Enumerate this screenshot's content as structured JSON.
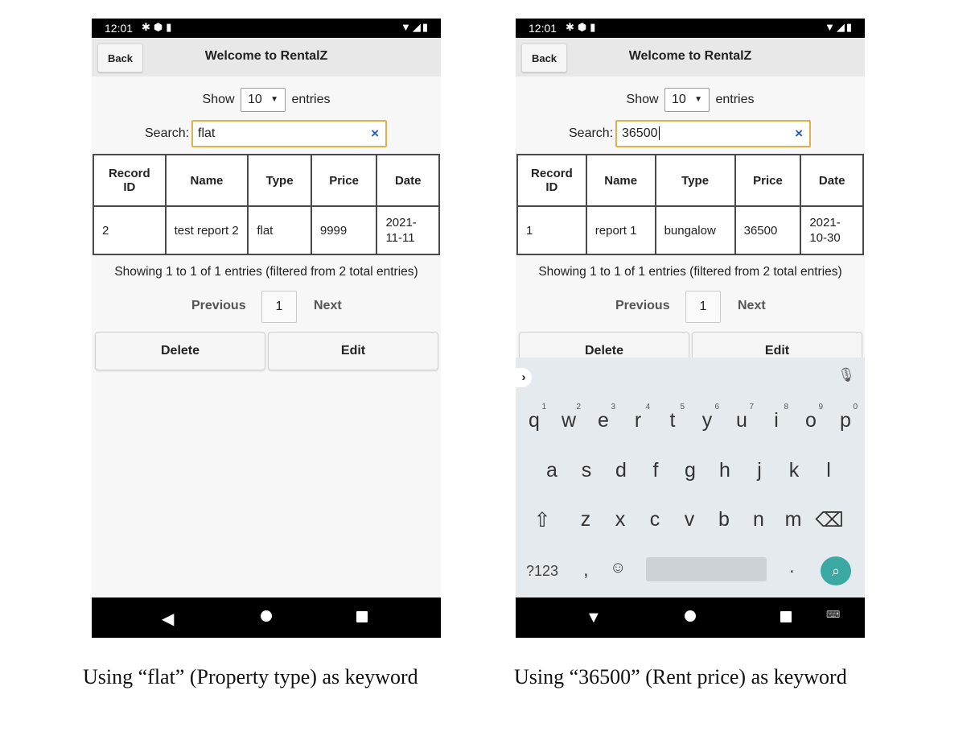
{
  "left": {
    "status_time": "12:01",
    "back_label": "Back",
    "title": "Welcome to RentalZ",
    "show_label": "Show",
    "entries_select": "10",
    "entries_label": "entries",
    "search_label": "Search:",
    "search_value": "flat",
    "clear_glyph": "×",
    "headers": [
      "Record ID",
      "Name",
      "Type",
      "Price",
      "Date"
    ],
    "row": [
      "2",
      "test report 2",
      "flat",
      "9999",
      "2021-11-11"
    ],
    "info": "Showing 1 to 1 of 1 entries (filtered from 2 total entries)",
    "prev_label": "Previous",
    "page_number": "1",
    "next_label": "Next",
    "delete_label": "Delete",
    "edit_label": "Edit"
  },
  "right": {
    "status_time": "12:01",
    "back_label": "Back",
    "title": "Welcome to RentalZ",
    "show_label": "Show",
    "entries_select": "10",
    "entries_label": "entries",
    "search_label": "Search:",
    "search_value": "36500",
    "clear_glyph": "×",
    "headers": [
      "Record ID",
      "Name",
      "Type",
      "Price",
      "Date"
    ],
    "row": [
      "1",
      "report 1",
      "bungalow",
      "36500",
      "2021-10-30"
    ],
    "info": "Showing 1 to 1 of 1 entries (filtered from 2 total entries)",
    "prev_label": "Previous",
    "page_number": "1",
    "next_label": "Next",
    "delete_label": "Delete",
    "edit_label": "Edit",
    "keyboard": {
      "row1": [
        "q",
        "w",
        "e",
        "r",
        "t",
        "y",
        "u",
        "i",
        "o",
        "p"
      ],
      "row1_hints": [
        "1",
        "2",
        "3",
        "4",
        "5",
        "6",
        "7",
        "8",
        "9",
        "0"
      ],
      "row2": [
        "a",
        "s",
        "d",
        "f",
        "g",
        "h",
        "j",
        "k",
        "l"
      ],
      "row3": [
        "z",
        "x",
        "c",
        "v",
        "b",
        "n",
        "m"
      ],
      "symbols_label": "?123",
      "comma": ",",
      "period": "."
    }
  },
  "captions": {
    "left": "Using “flat” (Property type) as keyword",
    "right": "Using “36500” (Rent price) as keyword"
  },
  "icons": {
    "status_left": "settings-icon, shield-icon, sim-card-icon",
    "status_right": "wifi-icon, signal-icon, battery-icon",
    "keyboard": "chevron-right-icon, mic-icon, shift-icon, backspace-icon, emoji-icon, search-icon"
  },
  "colors": {
    "search_border": "#e0b04a",
    "clear_icon": "#2a5aa8",
    "keyboard_bg": "#e4eaed",
    "search_key": "#3aa9a2"
  }
}
